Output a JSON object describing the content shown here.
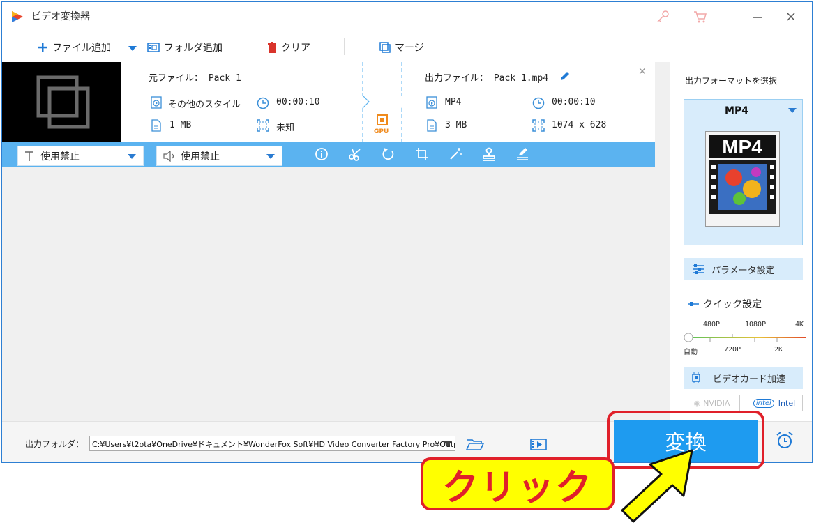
{
  "window": {
    "title": "ビデオ変換器"
  },
  "toolbar": {
    "add_file": "ファイル追加",
    "add_folder": "フォルダ追加",
    "clear": "クリア",
    "merge": "マージ"
  },
  "file": {
    "source_label": "元ファイル： Pack 1",
    "source_format": "その他のスタイル",
    "source_duration": "00:00:10",
    "source_size": "1 MB",
    "source_resolution": "未知",
    "output_label": "出力ファイル： Pack 1.mp4",
    "output_format": "MP4",
    "output_duration": "00:00:10",
    "output_size": "3 MB",
    "output_resolution": "1074 x 628",
    "gpu_badge": "GPU"
  },
  "edit_bar": {
    "subtitle": "使用禁止",
    "audio": "使用禁止"
  },
  "right_panel": {
    "title": "出力フォーマットを選択",
    "format_name": "MP4",
    "format_image_text": "MP4",
    "param_settings": "パラメータ設定",
    "quick_settings": "クイック設定",
    "slider_top": [
      "480P",
      "1080P",
      "4K"
    ],
    "slider_bottom": [
      "自動",
      "720P",
      "2K"
    ],
    "slider_value": "自動",
    "gpu_accel": "ビデオカード加速",
    "vendor_nvidia": "NVIDIA",
    "vendor_intel": "Intel"
  },
  "bottom": {
    "output_folder_label": "出力フォルダ：",
    "output_path": "C:¥Users¥t2ota¥OneDrive¥ドキュメント¥WonderFox Soft¥HD Video Converter Factory Pro¥OutputVideo¥",
    "convert": "変換"
  },
  "annotation": {
    "callout": "クリック"
  },
  "colors": {
    "accent": "#1e9bf0",
    "edit_bar": "#5bb3f0",
    "highlight_red": "#e0202a",
    "highlight_yellow": "#ffff00"
  }
}
